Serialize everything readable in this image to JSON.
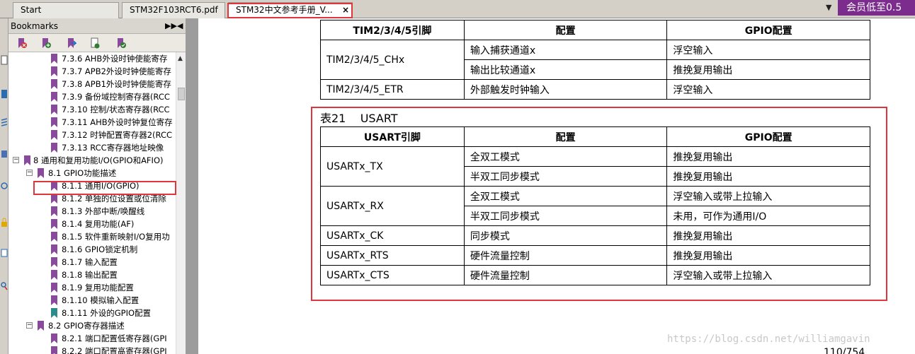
{
  "tabs": [
    {
      "label": "Start"
    },
    {
      "label": "STM32F103RCT6.pdf"
    },
    {
      "label": "STM32中文参考手册_V...",
      "close": "×"
    }
  ],
  "promo_text": "会员低至0.5",
  "bookmarks": {
    "title": "Bookmarks",
    "items": [
      {
        "label": "7.3.6 AHB外设时钟使能寄存"
      },
      {
        "label": "7.3.7 APB2外设时钟使能寄存"
      },
      {
        "label": "7.3.8 APB1外设时钟使能寄存"
      },
      {
        "label": "7.3.9 备份域控制寄存器(RCC"
      },
      {
        "label": "7.3.10 控制/状态寄存器(RCC"
      },
      {
        "label": "7.3.11 AHB外设时钟复位寄存"
      },
      {
        "label": "7.3.12 时钟配置寄存器2(RCC"
      },
      {
        "label": "7.3.13 RCC寄存器地址映像"
      },
      {
        "label": "8 通用和复用功能I/O(GPIO和AFIO)"
      },
      {
        "label": "8.1 GPIO功能描述"
      },
      {
        "label": "8.1.1 通用I/O(GPIO)"
      },
      {
        "label": "8.1.2 单独的位设置或位清除"
      },
      {
        "label": "8.1.3 外部中断/唤醒线"
      },
      {
        "label": "8.1.4 复用功能(AF)"
      },
      {
        "label": "8.1.5 软件重新映射I/O复用功"
      },
      {
        "label": "8.1.6 GPIO锁定机制"
      },
      {
        "label": "8.1.7 输入配置"
      },
      {
        "label": "8.1.8 输出配置"
      },
      {
        "label": "8.1.9 复用功能配置"
      },
      {
        "label": "8.1.10 模拟输入配置"
      },
      {
        "label": "8.1.11 外设的GPIO配置"
      },
      {
        "label": "8.2 GPIO寄存器描述"
      },
      {
        "label": "8.2.1 端口配置低寄存器(GPI"
      },
      {
        "label": "8.2.2 端口配置高寄存器(GPI"
      }
    ]
  },
  "tim_table": {
    "headers": [
      "TIM2/3/4/5引脚",
      "配置",
      "GPIO配置"
    ],
    "rows": [
      {
        "pin": "TIM2/3/4/5_CHx",
        "configs": [
          [
            "输入捕获通道x",
            "浮空输入"
          ],
          [
            "输出比较通道x",
            "推挽复用输出"
          ]
        ]
      },
      {
        "pin": "TIM2/3/4/5_ETR",
        "configs": [
          [
            "外部触发时钟输入",
            "浮空输入"
          ]
        ]
      }
    ]
  },
  "usart": {
    "caption": "表21    USART",
    "headers": [
      "USART引脚",
      "配置",
      "GPIO配置"
    ],
    "rows": [
      {
        "pin": "USARTx_TX",
        "configs": [
          [
            "全双工模式",
            "推挽复用输出"
          ],
          [
            "半双工同步模式",
            "推挽复用输出"
          ]
        ]
      },
      {
        "pin": "USARTx_RX",
        "configs": [
          [
            "全双工模式",
            "浮空输入或带上拉输入"
          ],
          [
            "半双工同步模式",
            "未用，可作为通用I/O"
          ]
        ]
      },
      {
        "pin": "USARTx_CK",
        "configs": [
          [
            "同步模式",
            "推挽复用输出"
          ]
        ]
      },
      {
        "pin": "USARTx_RTS",
        "configs": [
          [
            "硬件流量控制",
            "推挽复用输出"
          ]
        ]
      },
      {
        "pin": "USARTx_CTS",
        "configs": [
          [
            "硬件流量控制",
            "浮空输入或带上拉输入"
          ]
        ]
      }
    ]
  },
  "page_number": "110/754",
  "watermark": "https://blog.csdn.net/williamgavin",
  "colors": {
    "accent_red": "#e0363b",
    "promo_purple": "#7b2c8c"
  }
}
